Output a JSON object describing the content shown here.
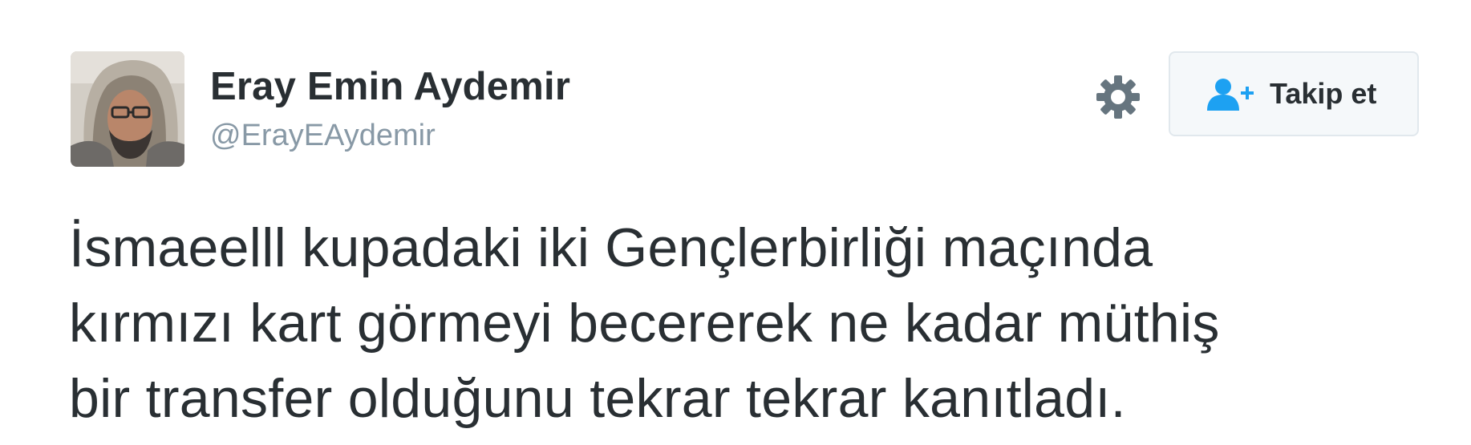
{
  "user": {
    "display_name": "Eray Emin Aydemir",
    "handle": "@ErayEAydemir",
    "avatar_icon": "profile-photo"
  },
  "actions": {
    "settings_icon": "gear-icon",
    "follow_icon": "add-user-icon",
    "follow_label": "Takip et"
  },
  "tweet": {
    "lines": [
      "İsmaeelll kupadaki iki Gençlerbirliği maçında",
      "kırmızı kart görmeyi becererek ne kadar müthiş",
      "bir transfer olduğunu tekrar tekrar kanıtladı."
    ]
  },
  "colors": {
    "text": "#292f33",
    "muted": "#8899a6",
    "accent": "#1da1f2",
    "button_bg": "#f5f8fa",
    "button_border": "#e1e8ed"
  }
}
